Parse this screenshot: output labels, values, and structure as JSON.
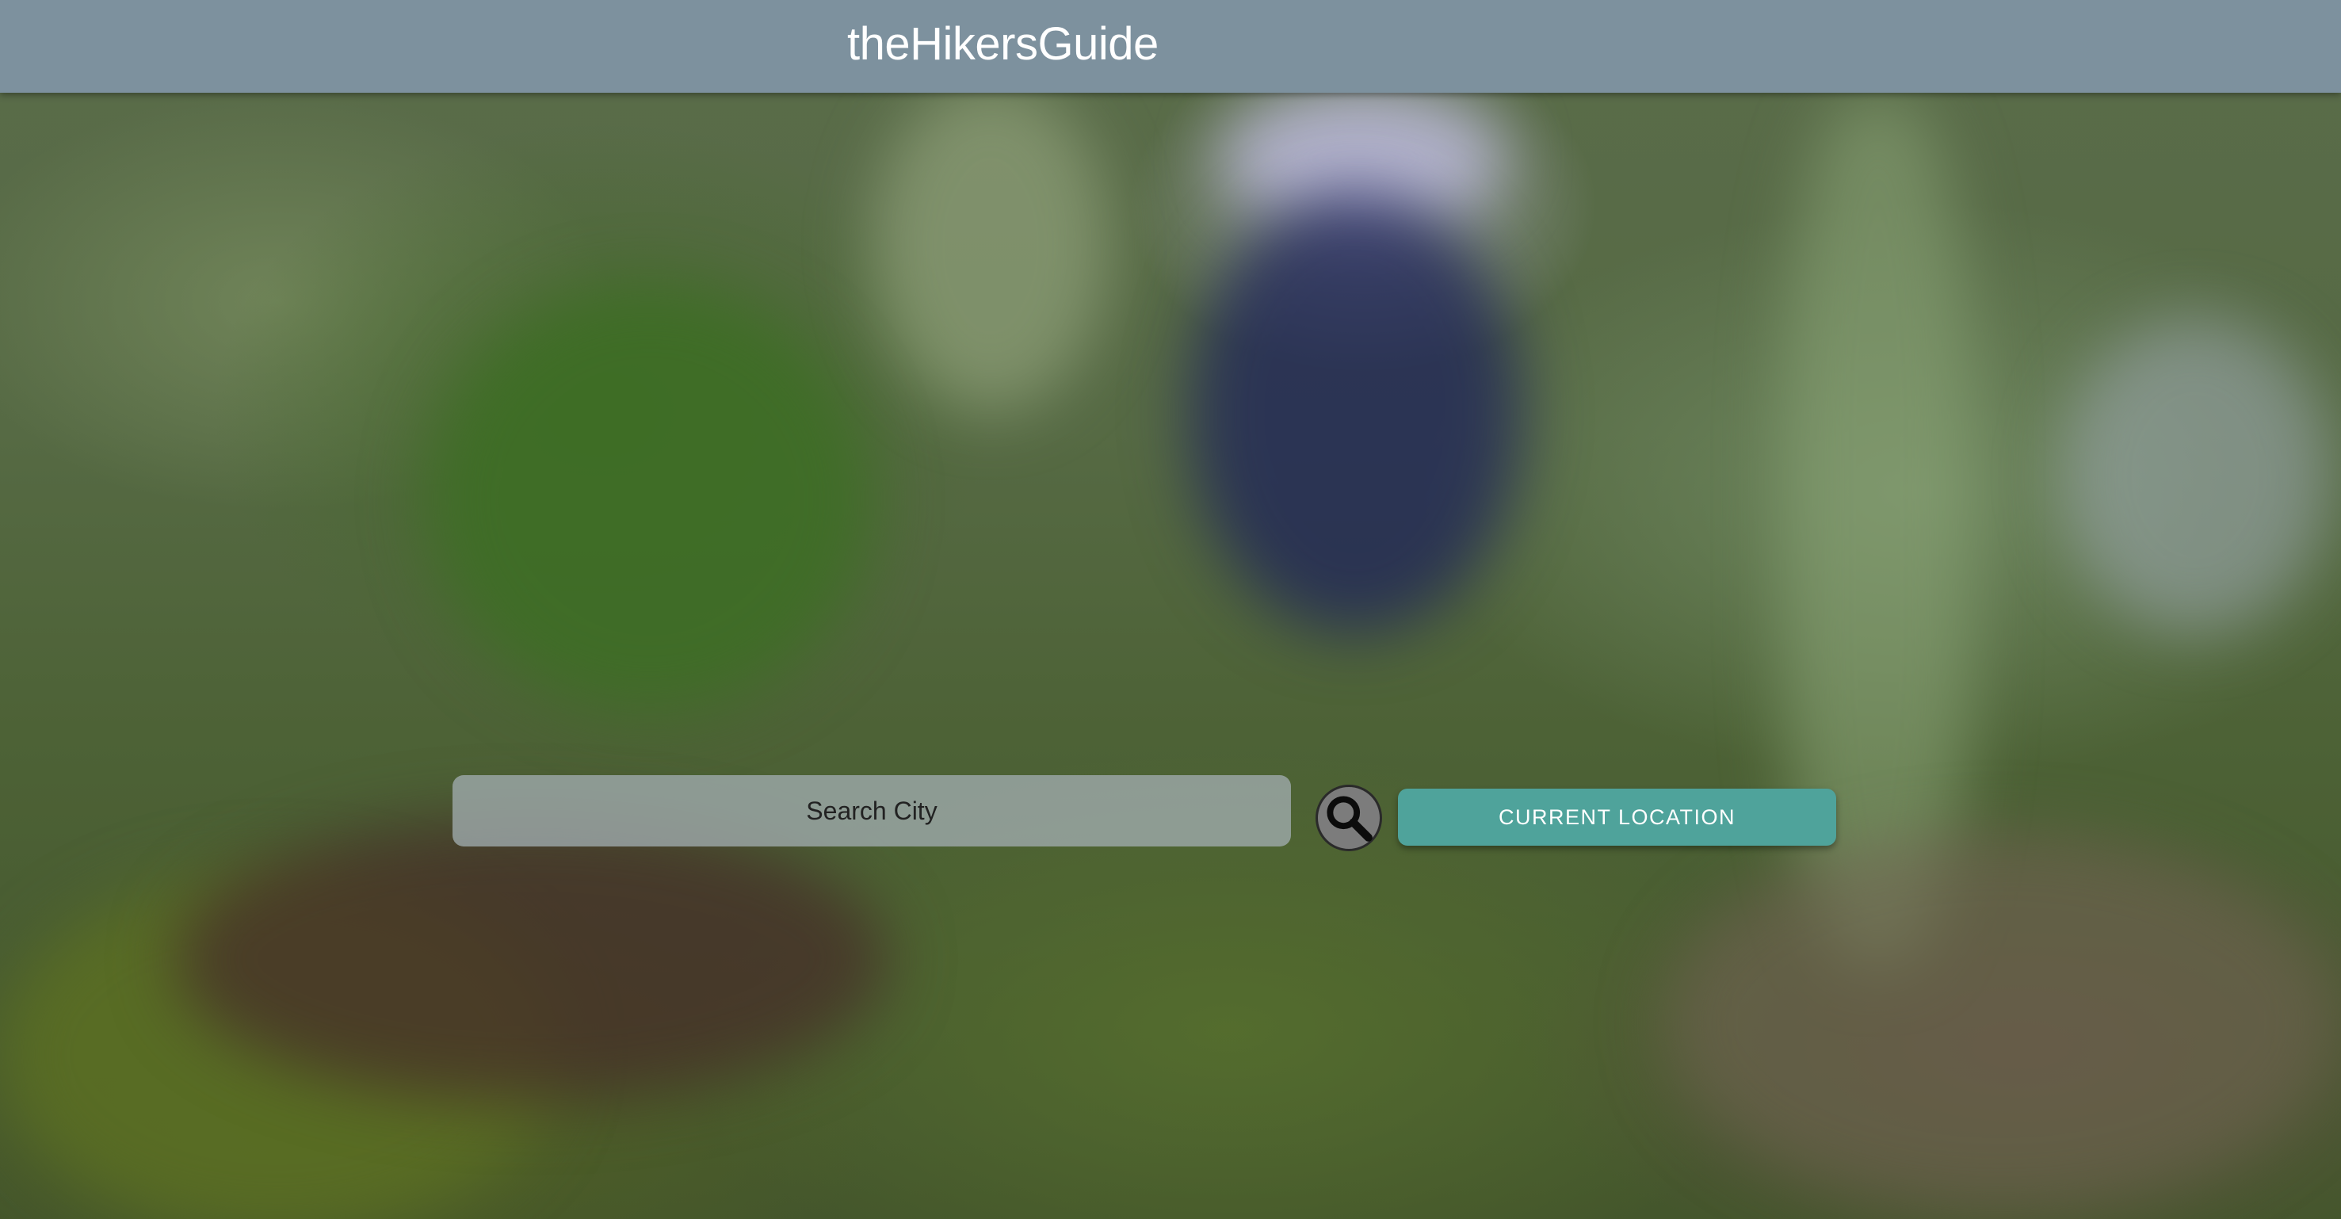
{
  "header": {
    "brand": "theHikersGuide",
    "background_color": "#7d919e"
  },
  "search": {
    "placeholder": "Search City",
    "value": "",
    "button_icon": "search-icon"
  },
  "actions": {
    "current_location_label": "CURRENT LOCATION",
    "accent_color": "#4fa39b"
  },
  "background": {
    "type": "blurred-forest-photo"
  }
}
